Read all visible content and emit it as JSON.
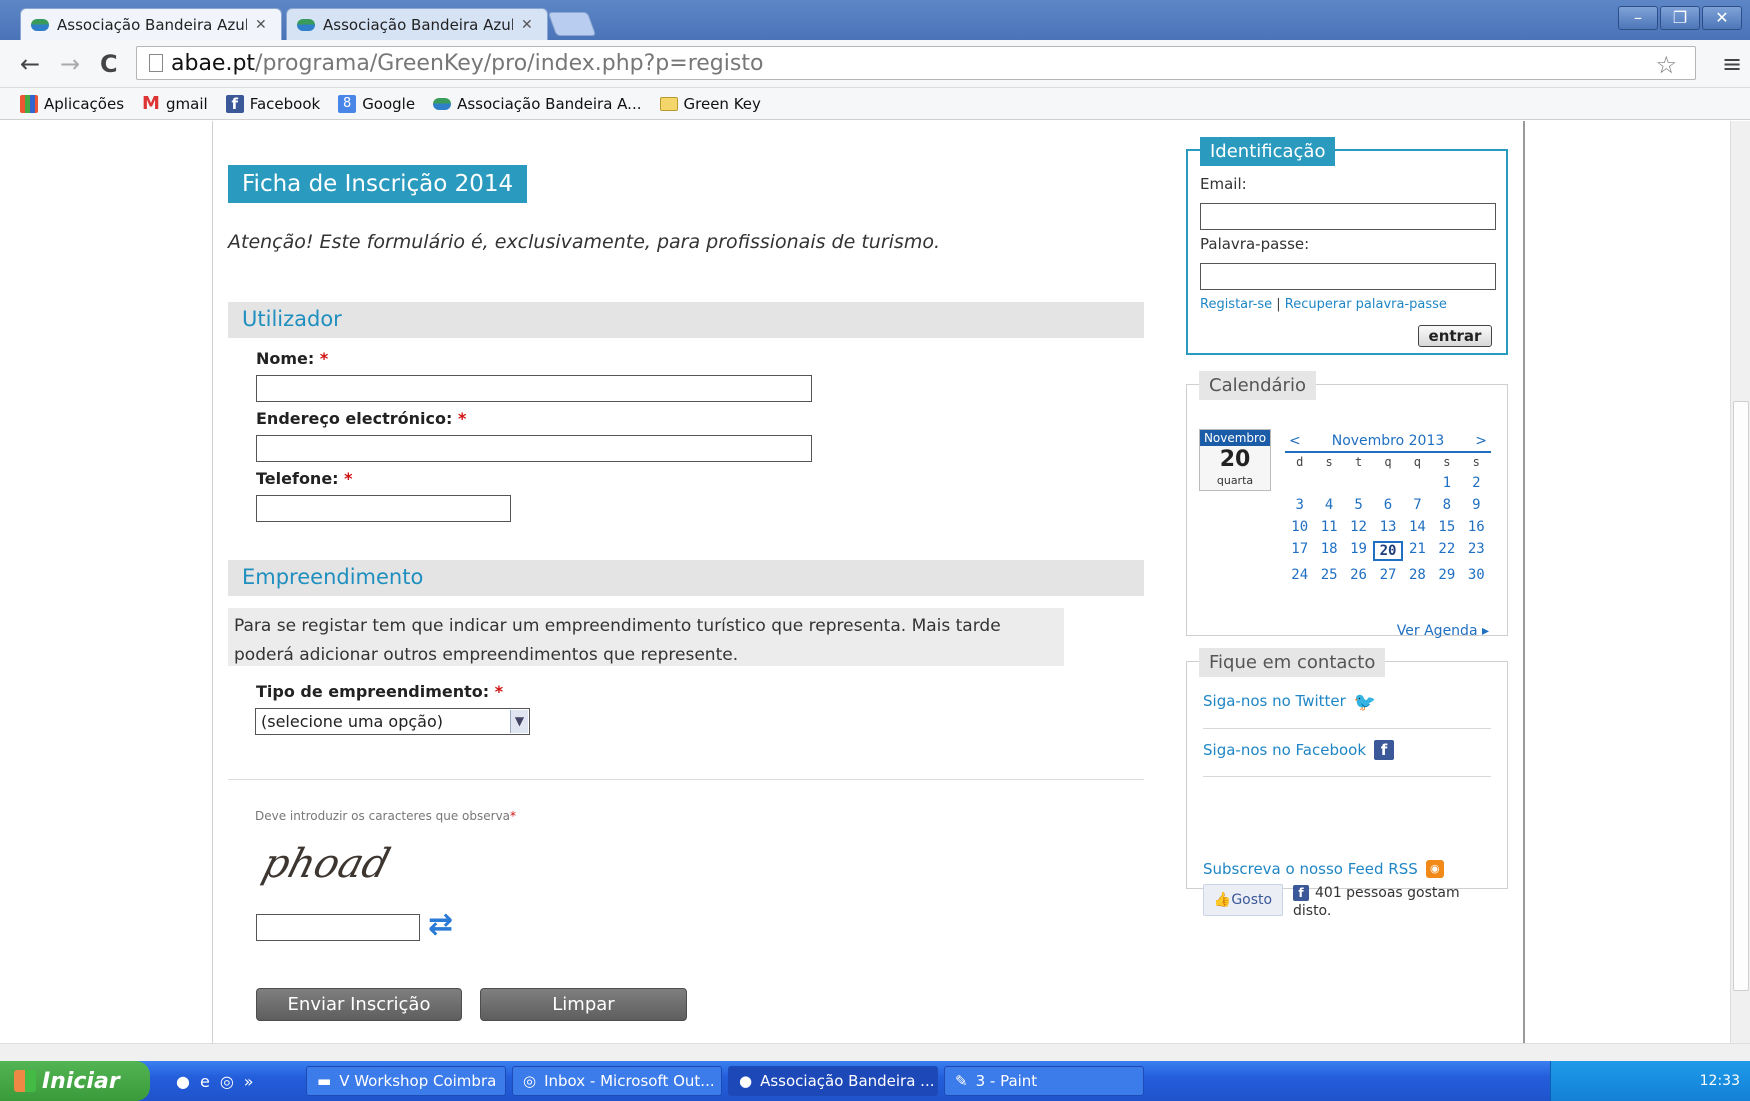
{
  "browser": {
    "tabs": [
      {
        "title": "Associação Bandeira Azul da"
      },
      {
        "title": "Associação Bandeira Azul da"
      }
    ],
    "url_host": "abae.pt",
    "url_path": "/programa/GreenKey/pro/index.php?p=registo",
    "bookmarks": [
      "Aplicações",
      "gmail",
      "Facebook",
      "Google",
      "Associação Bandeira A...",
      "Green Key"
    ]
  },
  "page": {
    "title": "Ficha de Inscrição 2014",
    "notice": "Atenção! Este formulário é, exclusivamente, para profissionais de turismo.",
    "user_section": {
      "title": "Utilizador",
      "name_label": "Nome:",
      "email_label": "Endereço electrónico:",
      "phone_label": "Telefone:",
      "required_mark": "*"
    },
    "business_section": {
      "title": "Empreendimento",
      "info": "Para se registar tem que indicar um empreendimento turístico que representa. Mais tarde poderá adicionar outros empreendimentos que represente.",
      "type_label": "Tipo de empreendimento:",
      "type_value": "(selecione uma opção)"
    },
    "captcha": {
      "label": "Deve introduzir os caracteres que observa",
      "image_text": "phoad"
    },
    "buttons": {
      "submit": "Enviar Inscrição",
      "clear": "Limpar"
    }
  },
  "sidebar": {
    "login": {
      "title": "Identificação",
      "email_label": "Email:",
      "password_label": "Palavra-passe:",
      "register_link": "Registar-se",
      "separator": "|",
      "recover_link": "Recuperar palavra-passe",
      "submit": "entrar"
    },
    "calendar": {
      "title": "Calendário",
      "badge_month": "Novembro",
      "badge_day": "20",
      "badge_weekday": "quarta",
      "prev": "<",
      "month_label": "Novembro 2013",
      "next": ">",
      "weekdays": [
        "d",
        "s",
        "t",
        "q",
        "q",
        "s",
        "s"
      ],
      "leading_blanks": 5,
      "days_in_month": 30,
      "today": 20,
      "agenda_link": "Ver Agenda ▸"
    },
    "contact": {
      "title": "Fique em contacto",
      "twitter": "Siga-nos no Twitter",
      "facebook": "Siga-nos no Facebook",
      "like_button": "Gosto",
      "like_text": "401 pessoas gostam disto.",
      "rss": "Subscreva o nosso Feed RSS"
    }
  },
  "taskbar": {
    "start": "Iniciar",
    "tasks": [
      "V Workshop Coimbra",
      "Inbox - Microsoft Out...",
      "Associação Bandeira ...",
      "3 - Paint"
    ],
    "clock": "12:33"
  }
}
